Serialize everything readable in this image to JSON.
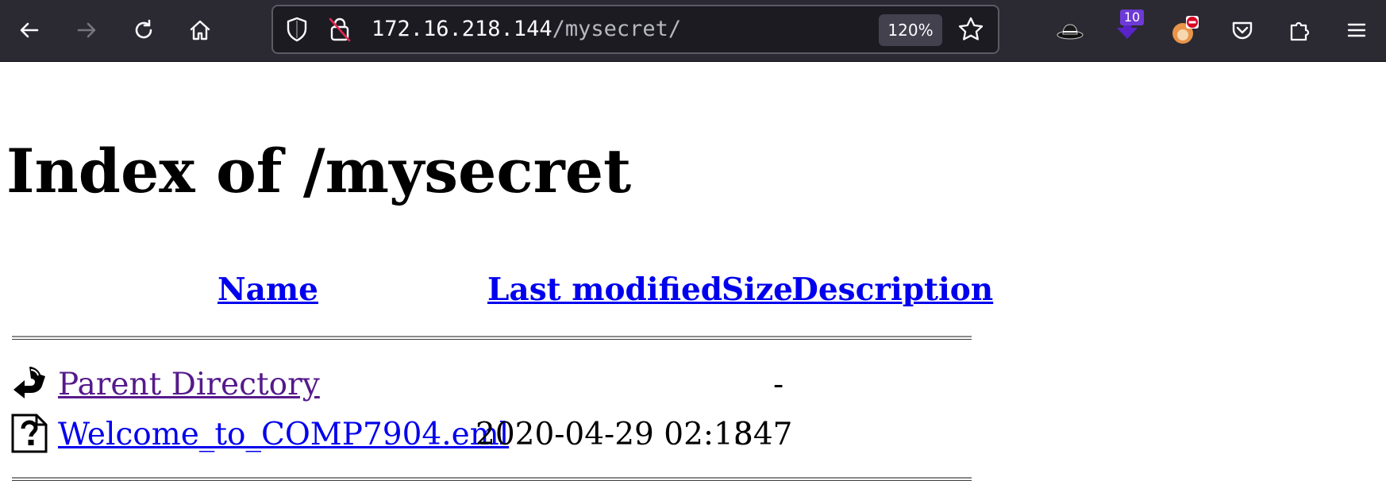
{
  "browser": {
    "url_host": "172.16.218.144",
    "url_path": "/mysecret/",
    "zoom": "120%",
    "extension_badge": "10"
  },
  "page": {
    "title": "Index of /mysecret",
    "columns": {
      "name": "Name",
      "last_modified": "Last modified",
      "size": "Size",
      "description": "Description"
    },
    "rows": [
      {
        "name": "Parent Directory",
        "modified": "",
        "size": "-",
        "icon": "back-arrow-icon"
      },
      {
        "name": "Welcome_to_COMP7904.eml",
        "modified": "2020-04-29 02:13",
        "size": "847",
        "icon": "unknown-file-icon"
      }
    ],
    "colors": {
      "link": "#0000ee",
      "visited": "#551a8b",
      "toolbar": "#2b2a33"
    }
  }
}
